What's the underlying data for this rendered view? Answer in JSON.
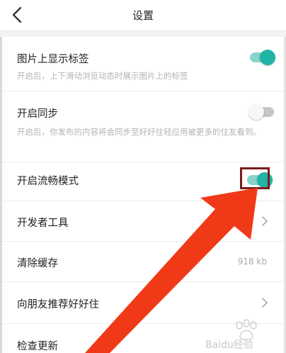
{
  "header": {
    "title": "设置"
  },
  "settings": {
    "show_tags": {
      "label": "图片上显示标签",
      "desc": "开启后，上下滑动浏览动态时展示图片上的标签",
      "enabled": true
    },
    "sync": {
      "label": "开启同步",
      "desc": "开启后，你发布的内容将会同步至好好住轻应用被更多的住友看到。",
      "enabled": false
    },
    "smooth_mode": {
      "label": "开启流畅模式",
      "enabled": true
    },
    "developer_tools": {
      "label": "开发者工具"
    },
    "clear_cache": {
      "label": "清除缓存",
      "value": "918 kb"
    },
    "recommend": {
      "label": "向朋友推荐好好住"
    },
    "check_update": {
      "label": "检查更新"
    }
  },
  "icons": {
    "back": "back-arrow-icon",
    "chevron": "chevron-right-icon"
  },
  "colors": {
    "toggle_on": "#21b3a4",
    "toggle_on_track": "#86d4cb",
    "toggle_off_track": "#c6c6c6",
    "annotation_arrow": "#f03a17",
    "annotation_box": "#7a1b1b"
  },
  "watermark": {
    "text": "Baidu经验"
  }
}
